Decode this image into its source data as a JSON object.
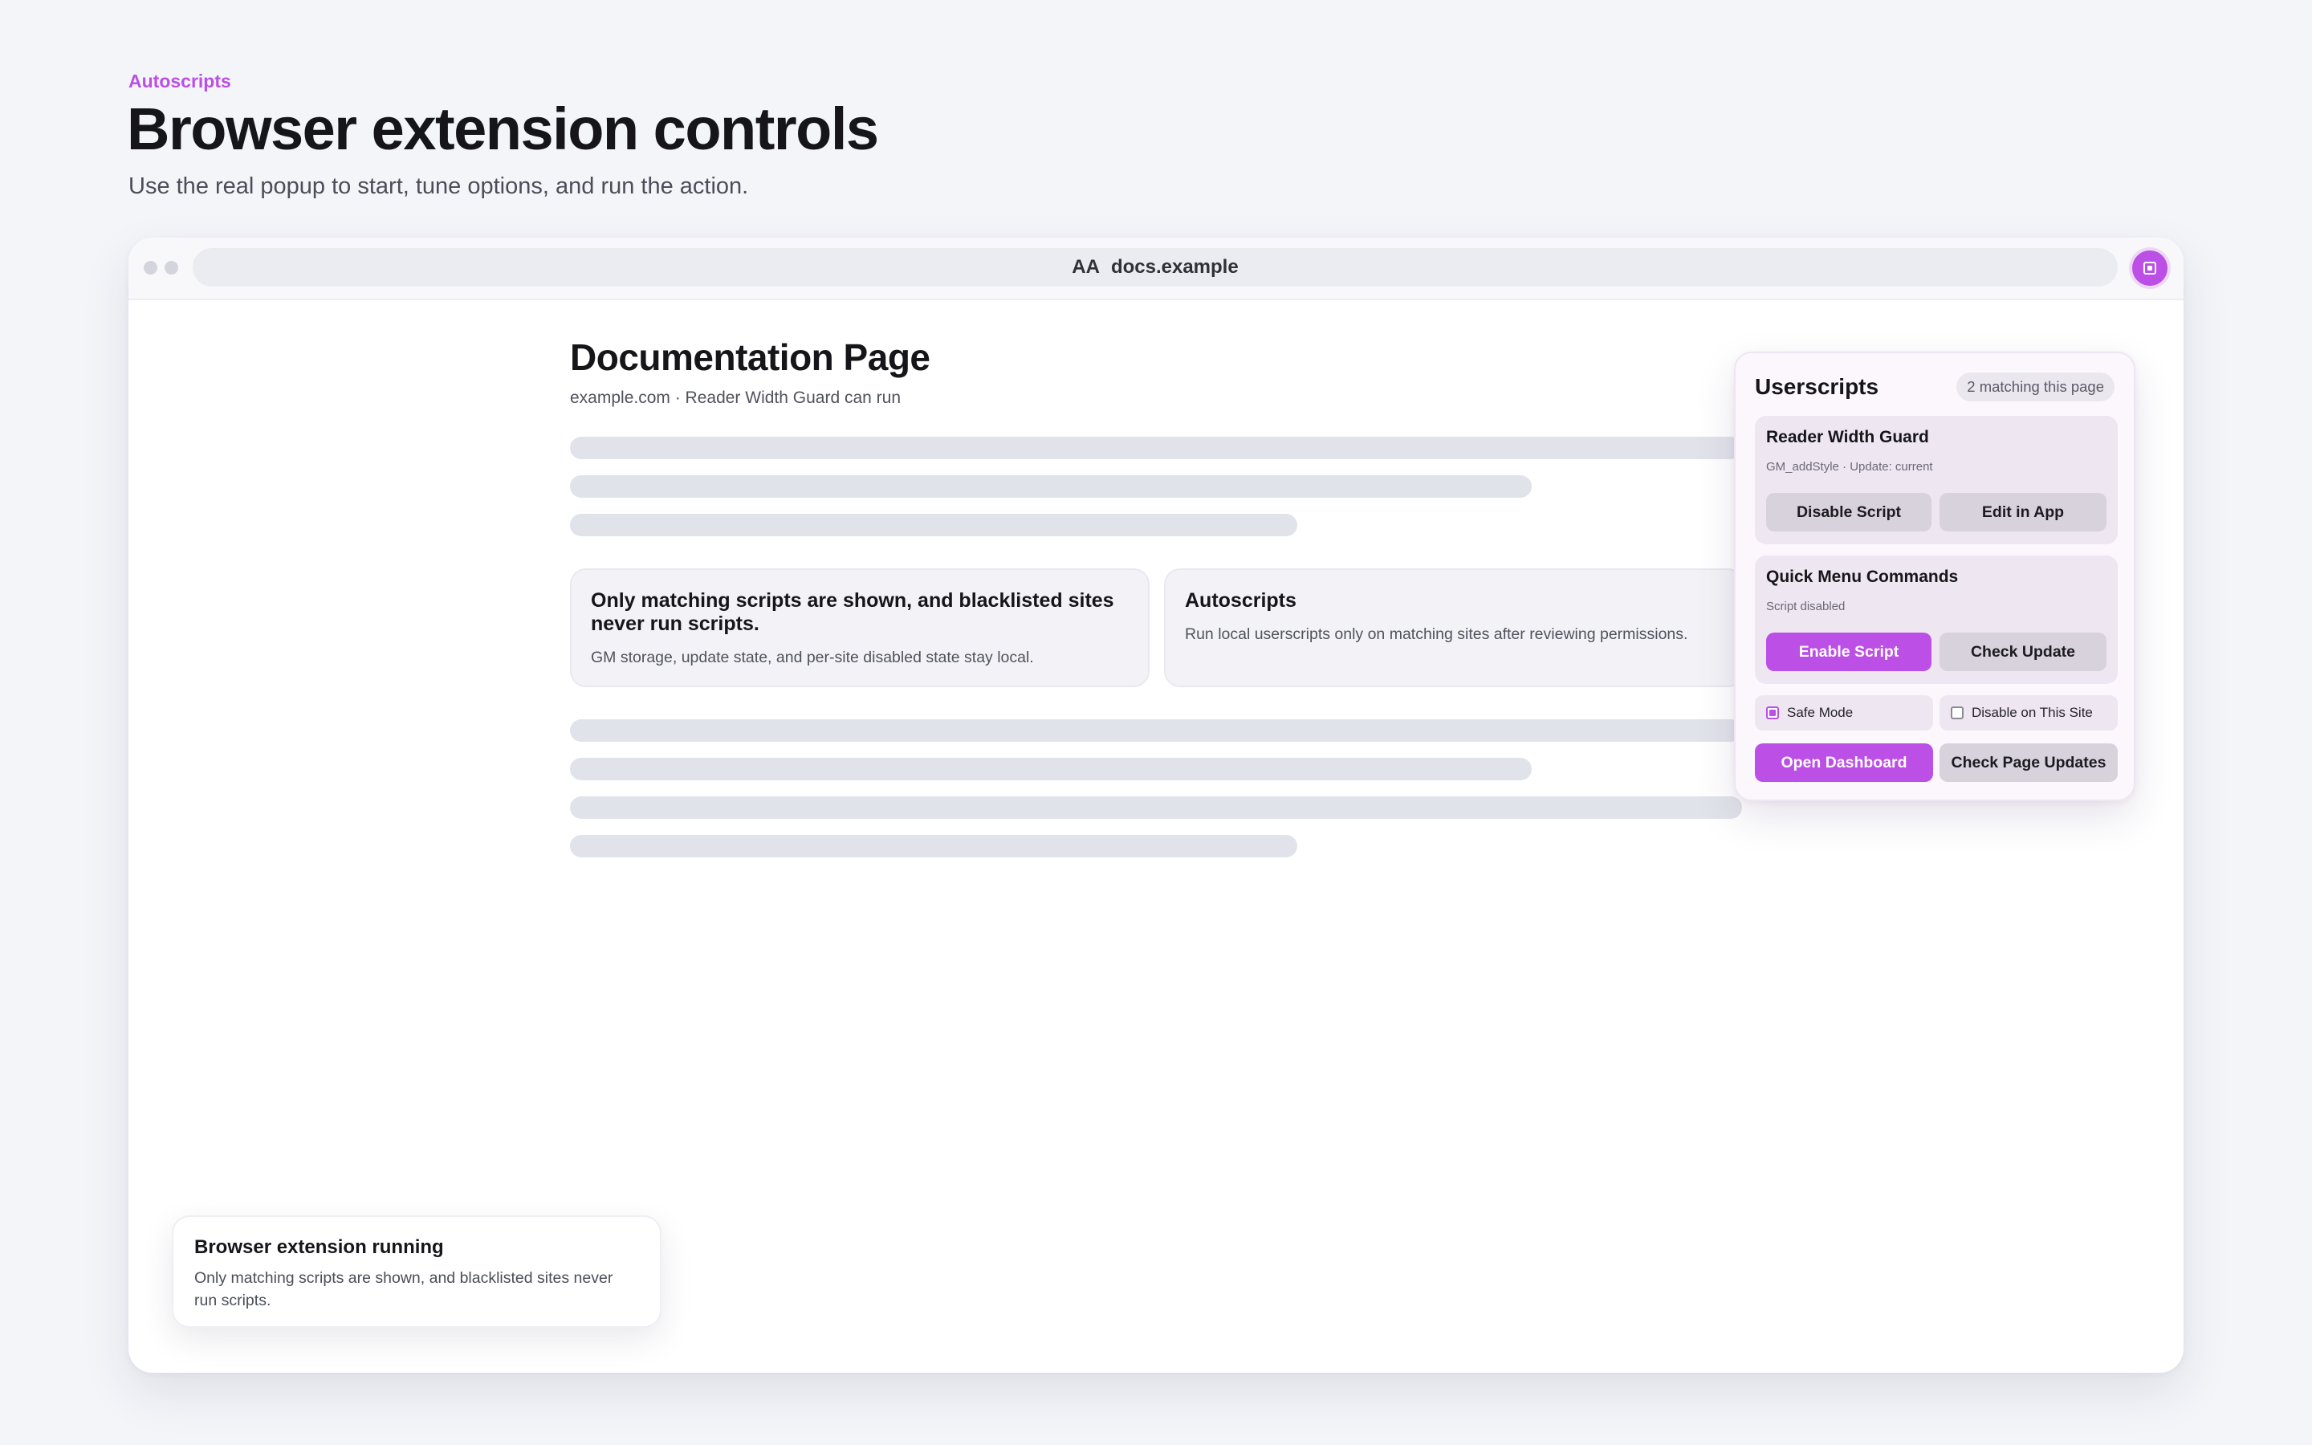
{
  "header": {
    "eyebrow": "Autoscripts",
    "title": "Browser extension controls",
    "subtitle": "Use the real popup to start, tune options, and run the action."
  },
  "browser": {
    "reader_label": "AA",
    "url": "docs.example",
    "extension_icon": "extension-square-icon"
  },
  "document": {
    "title": "Documentation Page",
    "meta": "example.com · Reader Width Guard can run",
    "cards": [
      {
        "title": "Only matching scripts are shown, and blacklisted sites never run scripts.",
        "text": "GM storage, update state, and per-site disabled state stay local."
      },
      {
        "title": "Autoscripts",
        "text": "Run local userscripts only on matching sites after reviewing permissions."
      }
    ]
  },
  "popup": {
    "title": "Userscripts",
    "badge": "2 matching this page",
    "scripts": [
      {
        "name": "Reader Width Guard",
        "meta": "GM_addStyle · Update: current",
        "primary_label": "Disable Script",
        "secondary_label": "Edit in App"
      },
      {
        "name": "Quick Menu Commands",
        "meta": "Script disabled",
        "primary_label": "Enable Script",
        "secondary_label": "Check Update"
      }
    ],
    "toggles": [
      {
        "label": "Safe Mode",
        "checked": true
      },
      {
        "label": "Disable on This Site",
        "checked": false
      }
    ],
    "footer": {
      "dashboard_label": "Open Dashboard",
      "updates_label": "Check Page Updates"
    }
  },
  "toast": {
    "title": "Browser extension running",
    "text": "Only matching scripts are shown, and blacklisted sites never run scripts."
  },
  "colors": {
    "accent": "#bb4fe6",
    "background": "#f4f5f9",
    "skeleton": "#e1e3ea"
  }
}
